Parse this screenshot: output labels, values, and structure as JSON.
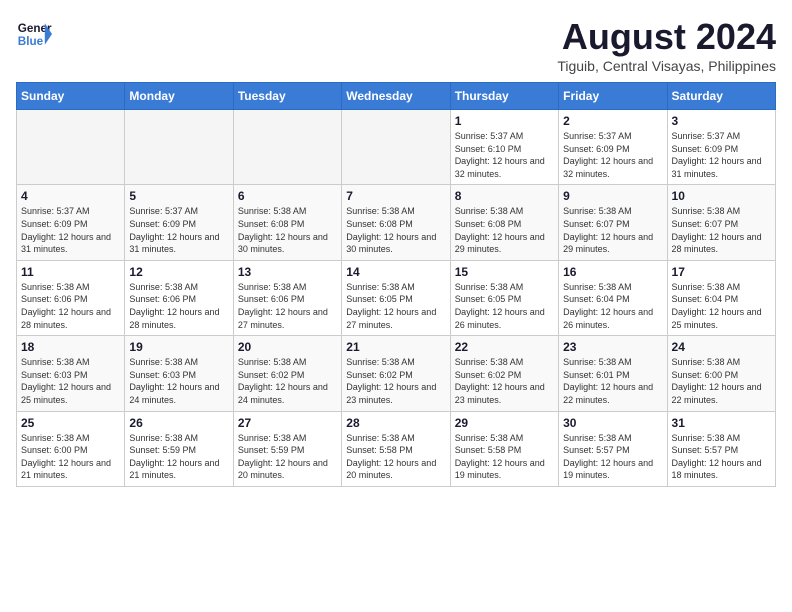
{
  "header": {
    "logo_line1": "General",
    "logo_line2": "Blue",
    "month_year": "August 2024",
    "location": "Tiguib, Central Visayas, Philippines"
  },
  "days_of_week": [
    "Sunday",
    "Monday",
    "Tuesday",
    "Wednesday",
    "Thursday",
    "Friday",
    "Saturday"
  ],
  "weeks": [
    [
      {
        "day": "",
        "empty": true
      },
      {
        "day": "",
        "empty": true
      },
      {
        "day": "",
        "empty": true
      },
      {
        "day": "",
        "empty": true
      },
      {
        "day": "1",
        "sunrise": "5:37 AM",
        "sunset": "6:10 PM",
        "daylight": "12 hours and 32 minutes."
      },
      {
        "day": "2",
        "sunrise": "5:37 AM",
        "sunset": "6:09 PM",
        "daylight": "12 hours and 32 minutes."
      },
      {
        "day": "3",
        "sunrise": "5:37 AM",
        "sunset": "6:09 PM",
        "daylight": "12 hours and 31 minutes."
      }
    ],
    [
      {
        "day": "4",
        "sunrise": "5:37 AM",
        "sunset": "6:09 PM",
        "daylight": "12 hours and 31 minutes."
      },
      {
        "day": "5",
        "sunrise": "5:37 AM",
        "sunset": "6:09 PM",
        "daylight": "12 hours and 31 minutes."
      },
      {
        "day": "6",
        "sunrise": "5:38 AM",
        "sunset": "6:08 PM",
        "daylight": "12 hours and 30 minutes."
      },
      {
        "day": "7",
        "sunrise": "5:38 AM",
        "sunset": "6:08 PM",
        "daylight": "12 hours and 30 minutes."
      },
      {
        "day": "8",
        "sunrise": "5:38 AM",
        "sunset": "6:08 PM",
        "daylight": "12 hours and 29 minutes."
      },
      {
        "day": "9",
        "sunrise": "5:38 AM",
        "sunset": "6:07 PM",
        "daylight": "12 hours and 29 minutes."
      },
      {
        "day": "10",
        "sunrise": "5:38 AM",
        "sunset": "6:07 PM",
        "daylight": "12 hours and 28 minutes."
      }
    ],
    [
      {
        "day": "11",
        "sunrise": "5:38 AM",
        "sunset": "6:06 PM",
        "daylight": "12 hours and 28 minutes."
      },
      {
        "day": "12",
        "sunrise": "5:38 AM",
        "sunset": "6:06 PM",
        "daylight": "12 hours and 28 minutes."
      },
      {
        "day": "13",
        "sunrise": "5:38 AM",
        "sunset": "6:06 PM",
        "daylight": "12 hours and 27 minutes."
      },
      {
        "day": "14",
        "sunrise": "5:38 AM",
        "sunset": "6:05 PM",
        "daylight": "12 hours and 27 minutes."
      },
      {
        "day": "15",
        "sunrise": "5:38 AM",
        "sunset": "6:05 PM",
        "daylight": "12 hours and 26 minutes."
      },
      {
        "day": "16",
        "sunrise": "5:38 AM",
        "sunset": "6:04 PM",
        "daylight": "12 hours and 26 minutes."
      },
      {
        "day": "17",
        "sunrise": "5:38 AM",
        "sunset": "6:04 PM",
        "daylight": "12 hours and 25 minutes."
      }
    ],
    [
      {
        "day": "18",
        "sunrise": "5:38 AM",
        "sunset": "6:03 PM",
        "daylight": "12 hours and 25 minutes."
      },
      {
        "day": "19",
        "sunrise": "5:38 AM",
        "sunset": "6:03 PM",
        "daylight": "12 hours and 24 minutes."
      },
      {
        "day": "20",
        "sunrise": "5:38 AM",
        "sunset": "6:02 PM",
        "daylight": "12 hours and 24 minutes."
      },
      {
        "day": "21",
        "sunrise": "5:38 AM",
        "sunset": "6:02 PM",
        "daylight": "12 hours and 23 minutes."
      },
      {
        "day": "22",
        "sunrise": "5:38 AM",
        "sunset": "6:02 PM",
        "daylight": "12 hours and 23 minutes."
      },
      {
        "day": "23",
        "sunrise": "5:38 AM",
        "sunset": "6:01 PM",
        "daylight": "12 hours and 22 minutes."
      },
      {
        "day": "24",
        "sunrise": "5:38 AM",
        "sunset": "6:00 PM",
        "daylight": "12 hours and 22 minutes."
      }
    ],
    [
      {
        "day": "25",
        "sunrise": "5:38 AM",
        "sunset": "6:00 PM",
        "daylight": "12 hours and 21 minutes."
      },
      {
        "day": "26",
        "sunrise": "5:38 AM",
        "sunset": "5:59 PM",
        "daylight": "12 hours and 21 minutes."
      },
      {
        "day": "27",
        "sunrise": "5:38 AM",
        "sunset": "5:59 PM",
        "daylight": "12 hours and 20 minutes."
      },
      {
        "day": "28",
        "sunrise": "5:38 AM",
        "sunset": "5:58 PM",
        "daylight": "12 hours and 20 minutes."
      },
      {
        "day": "29",
        "sunrise": "5:38 AM",
        "sunset": "5:58 PM",
        "daylight": "12 hours and 19 minutes."
      },
      {
        "day": "30",
        "sunrise": "5:38 AM",
        "sunset": "5:57 PM",
        "daylight": "12 hours and 19 minutes."
      },
      {
        "day": "31",
        "sunrise": "5:38 AM",
        "sunset": "5:57 PM",
        "daylight": "12 hours and 18 minutes."
      }
    ]
  ]
}
